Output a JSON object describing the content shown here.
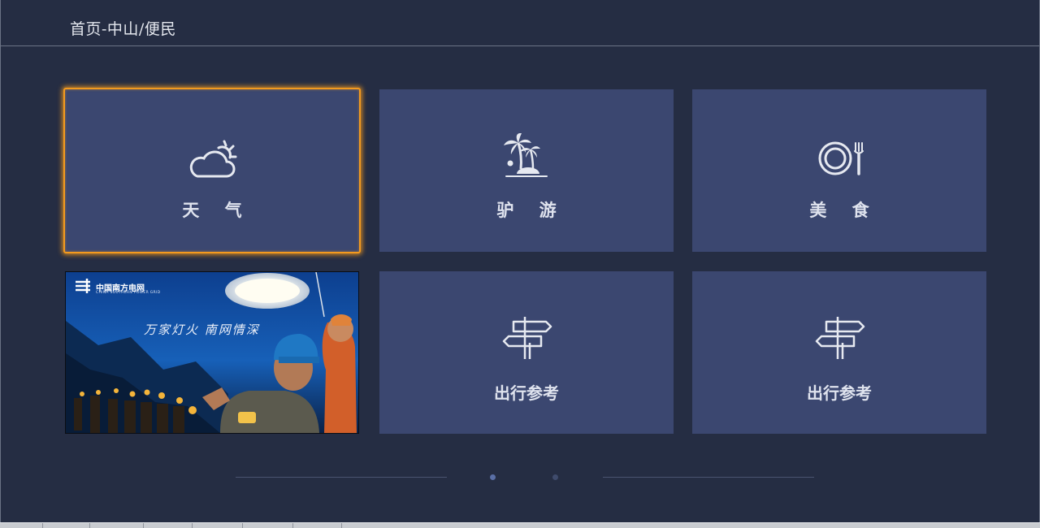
{
  "header": {
    "breadcrumb": "首页-中山/便民"
  },
  "tiles": [
    {
      "label": "天 气",
      "icon": "cloud-sun-icon"
    },
    {
      "label": "驴 游",
      "icon": "palm-island-icon"
    },
    {
      "label": "美 食",
      "icon": "plate-fork-icon"
    },
    {
      "label": "出行参考",
      "icon": "signpost-icon"
    },
    {
      "label": "出行参考",
      "icon": "signpost-icon"
    }
  ],
  "banner": {
    "logo_text": "中国南方电网",
    "logo_sub": "CHINA SOUTHERN POWER GRID",
    "slogan": "万家灯火  南网情深"
  },
  "pager": {
    "count": 2,
    "active_index": 0
  },
  "colors": {
    "background": "#252d43",
    "tile": "#3b4770",
    "focus": "#f39a1f",
    "dot_active": "#5a6fa6",
    "dot_inactive": "#3f4b6c"
  }
}
